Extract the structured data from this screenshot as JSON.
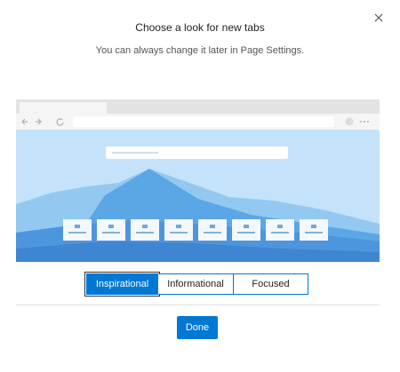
{
  "dialog": {
    "title": "Choose a look for new tabs",
    "subtitle": "You can always change it later in Page Settings."
  },
  "close": {
    "icon": "close-icon"
  },
  "preview": {
    "browser_icons": [
      "back-arrow-icon",
      "forward-arrow-icon",
      "refresh-icon",
      "profile-avatar-icon",
      "more-dots-icon"
    ],
    "tile_count": 8,
    "colors": {
      "sky": "#c4e3fa",
      "mountain_far": "#5ba7e6",
      "mountain_light": "#93c9f1",
      "ground": "#4d95dd",
      "accent": "#0078d4"
    }
  },
  "layouts": {
    "options": [
      {
        "label": "Inspirational",
        "selected": true
      },
      {
        "label": "Informational",
        "selected": false
      },
      {
        "label": "Focused",
        "selected": false
      }
    ]
  },
  "footer": {
    "done_label": "Done"
  }
}
